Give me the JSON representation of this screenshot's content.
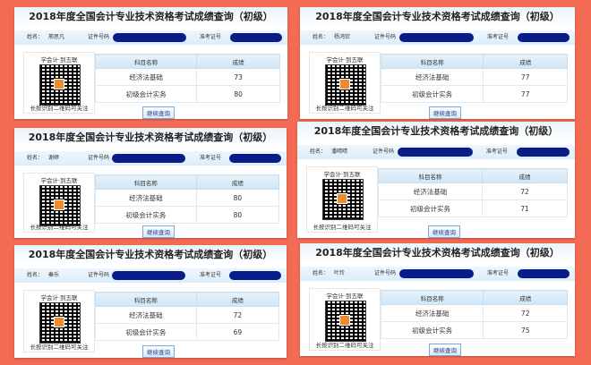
{
  "title": "2018年度全国会计专业技术资格考试成绩查询（初级）",
  "labels": {
    "name": "姓名：",
    "id": "证件号码",
    "ticket": "准考证号",
    "subject": "科目名称",
    "score": "成绩"
  },
  "qr": {
    "head": "学会计·到五联",
    "foot": "长按识别二维码可关注"
  },
  "button": "继续查询",
  "colors": {
    "background": "#f36b54",
    "redaction": "#0a1c8a",
    "header_blue": "#cfe6f6"
  },
  "panels": [
    {
      "name": "邢思凡",
      "rows": [
        {
          "subject": "经济法基础",
          "score": "73"
        },
        {
          "subject": "初级会计实务",
          "score": "80"
        }
      ]
    },
    {
      "name": "杨鸿钦",
      "rows": [
        {
          "subject": "经济法基础",
          "score": "77"
        },
        {
          "subject": "初级会计实务",
          "score": "77"
        }
      ]
    },
    {
      "name": "谢婷",
      "rows": [
        {
          "subject": "经济法基础",
          "score": "80"
        },
        {
          "subject": "初级会计实务",
          "score": "80"
        }
      ]
    },
    {
      "name": "潘晴晴",
      "rows": [
        {
          "subject": "经济法基础",
          "score": "72"
        },
        {
          "subject": "初级会计实务",
          "score": "71"
        }
      ]
    },
    {
      "name": "秦乐",
      "rows": [
        {
          "subject": "经济法基础",
          "score": "72"
        },
        {
          "subject": "初级会计实务",
          "score": "69"
        }
      ]
    },
    {
      "name": "叶玲",
      "rows": [
        {
          "subject": "经济法基础",
          "score": "72"
        },
        {
          "subject": "初级会计实务",
          "score": "75"
        }
      ]
    }
  ]
}
